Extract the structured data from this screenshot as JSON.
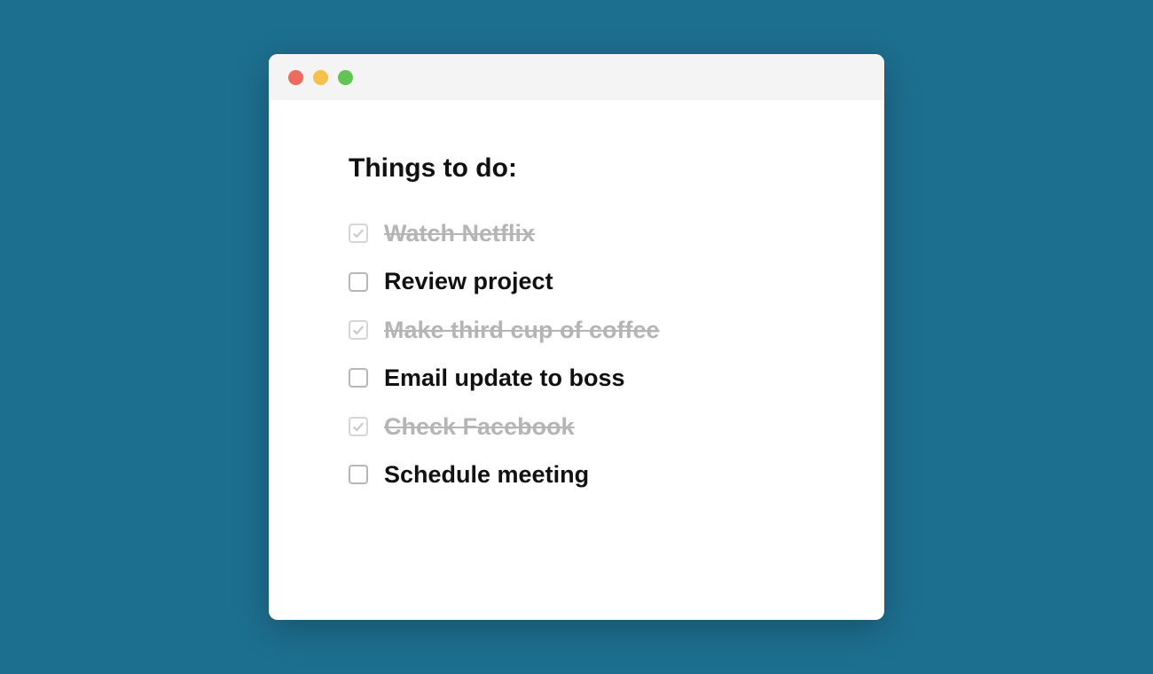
{
  "title": "Things to do:",
  "items": [
    {
      "label": "Watch Netflix",
      "done": true
    },
    {
      "label": "Review project",
      "done": false
    },
    {
      "label": "Make third cup of coffee",
      "done": true
    },
    {
      "label": "Email update to boss",
      "done": false
    },
    {
      "label": "Check Facebook",
      "done": true
    },
    {
      "label": "Schedule meeting",
      "done": false
    }
  ]
}
